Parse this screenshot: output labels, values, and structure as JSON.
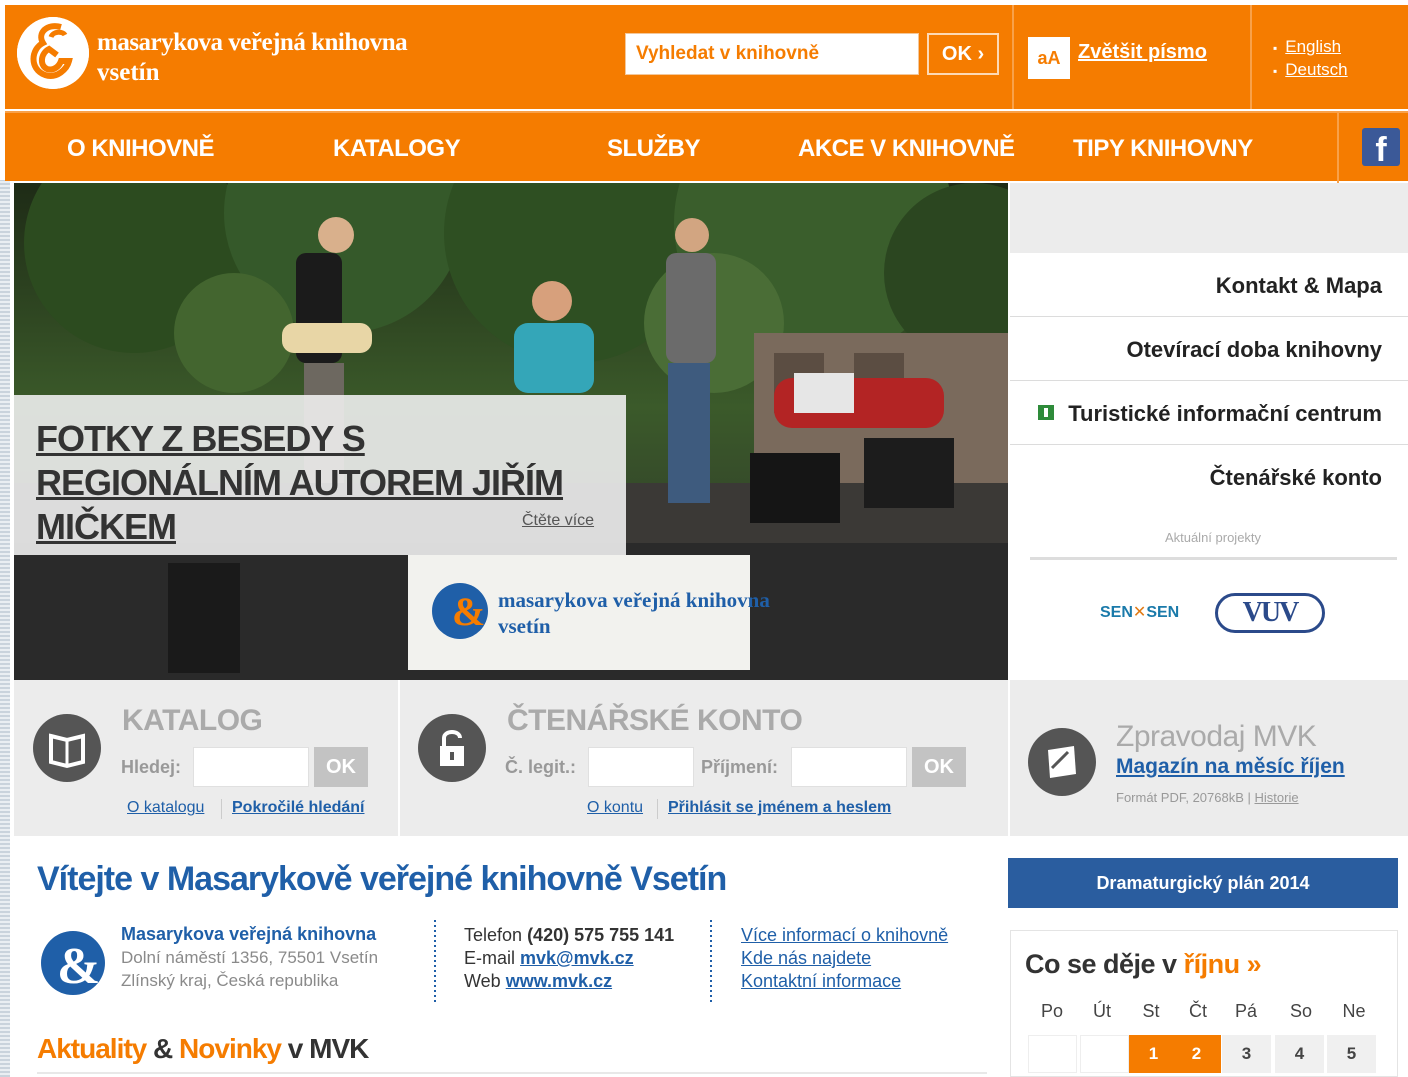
{
  "header": {
    "logo_line1": "masarykova veřejná knihovna",
    "logo_line2": "vsetín",
    "search_placeholder": "Vyhledat v knihovně",
    "search_button": "OK ›",
    "font_icon": "aA",
    "enlarge_font": "Zvětšit písmo",
    "languages": [
      "English",
      "Deutsch"
    ]
  },
  "nav": {
    "items": [
      "O KNIHOVNĚ",
      "KATALOGY",
      "SLUŽBY",
      "AKCE V KNIHOVNĚ",
      "TIPY KNIHOVNY"
    ],
    "facebook_glyph": "f"
  },
  "hero": {
    "title": "FOTKY Z BESEDY S REGIONÁLNÍM AUTOREM JIŘÍM MIČKEM",
    "read_more": "Čtěte více",
    "banner_line1": "masarykova veřejná knihovna",
    "banner_line2": "vsetín"
  },
  "right_menu": {
    "items": [
      "Kontakt & Mapa",
      "Otevírací doba knihovny",
      "Turistické informační centrum",
      "Čtenářské konto"
    ],
    "projects_caption": "Aktuální projekty",
    "projects": [
      "SEN",
      "SEN",
      "VUV"
    ]
  },
  "tools": {
    "catalog": {
      "title": "KATALOG",
      "search_label": "Hledej:",
      "ok": "OK",
      "links": [
        "O katalogu",
        "Pokročilé hledání"
      ]
    },
    "account": {
      "title": "ČTENÁŘSKÉ KONTO",
      "id_label": "Č. legit.:",
      "surname_label": "Příjmení:",
      "ok": "OK",
      "links": [
        "O kontu",
        "Přihlásit se jménem a heslem"
      ]
    },
    "newsletter": {
      "title": "Zpravodaj MVK",
      "link": "Magazín na měsíc říjen",
      "meta": "Formát PDF, 20768kB",
      "history": "Historie"
    }
  },
  "welcome": {
    "heading": "Vítejte v Masarykově veřejné knihovně Vsetín",
    "org_name": "Masarykova veřejná knihovna",
    "address1": "Dolní náměstí 1356, 75501 Vsetín",
    "address2": "Zlínský kraj, Česká republika",
    "phone_label": "Telefon",
    "phone": "(420) 575 755 141",
    "email_label": "E-mail",
    "email": "mvk@mvk.cz",
    "web_label": "Web",
    "web": "www.mvk.cz",
    "info_links": [
      "Více informací o knihovně",
      "Kde nás najdete",
      "Kontaktní informace"
    ]
  },
  "news": {
    "word1": "Aktuality",
    "amp": "&",
    "word2": "Novinky",
    "suffix": "v MVK"
  },
  "sidebar_bottom": {
    "drama_button": "Dramaturgický plán 2014",
    "calendar_title_prefix": "Co se děje v",
    "calendar_month": "říjnu »",
    "weekdays": [
      "Po",
      "Út",
      "St",
      "Čt",
      "Pá",
      "So",
      "Ne"
    ],
    "first_row": [
      "",
      "",
      "1",
      "2",
      "3",
      "4",
      "5"
    ],
    "highlighted_days": [
      "1",
      "2"
    ]
  },
  "colors": {
    "brand_orange": "#f57c00",
    "link_blue": "#1f5fa8",
    "dark_blue_button": "#2a5d9f"
  }
}
